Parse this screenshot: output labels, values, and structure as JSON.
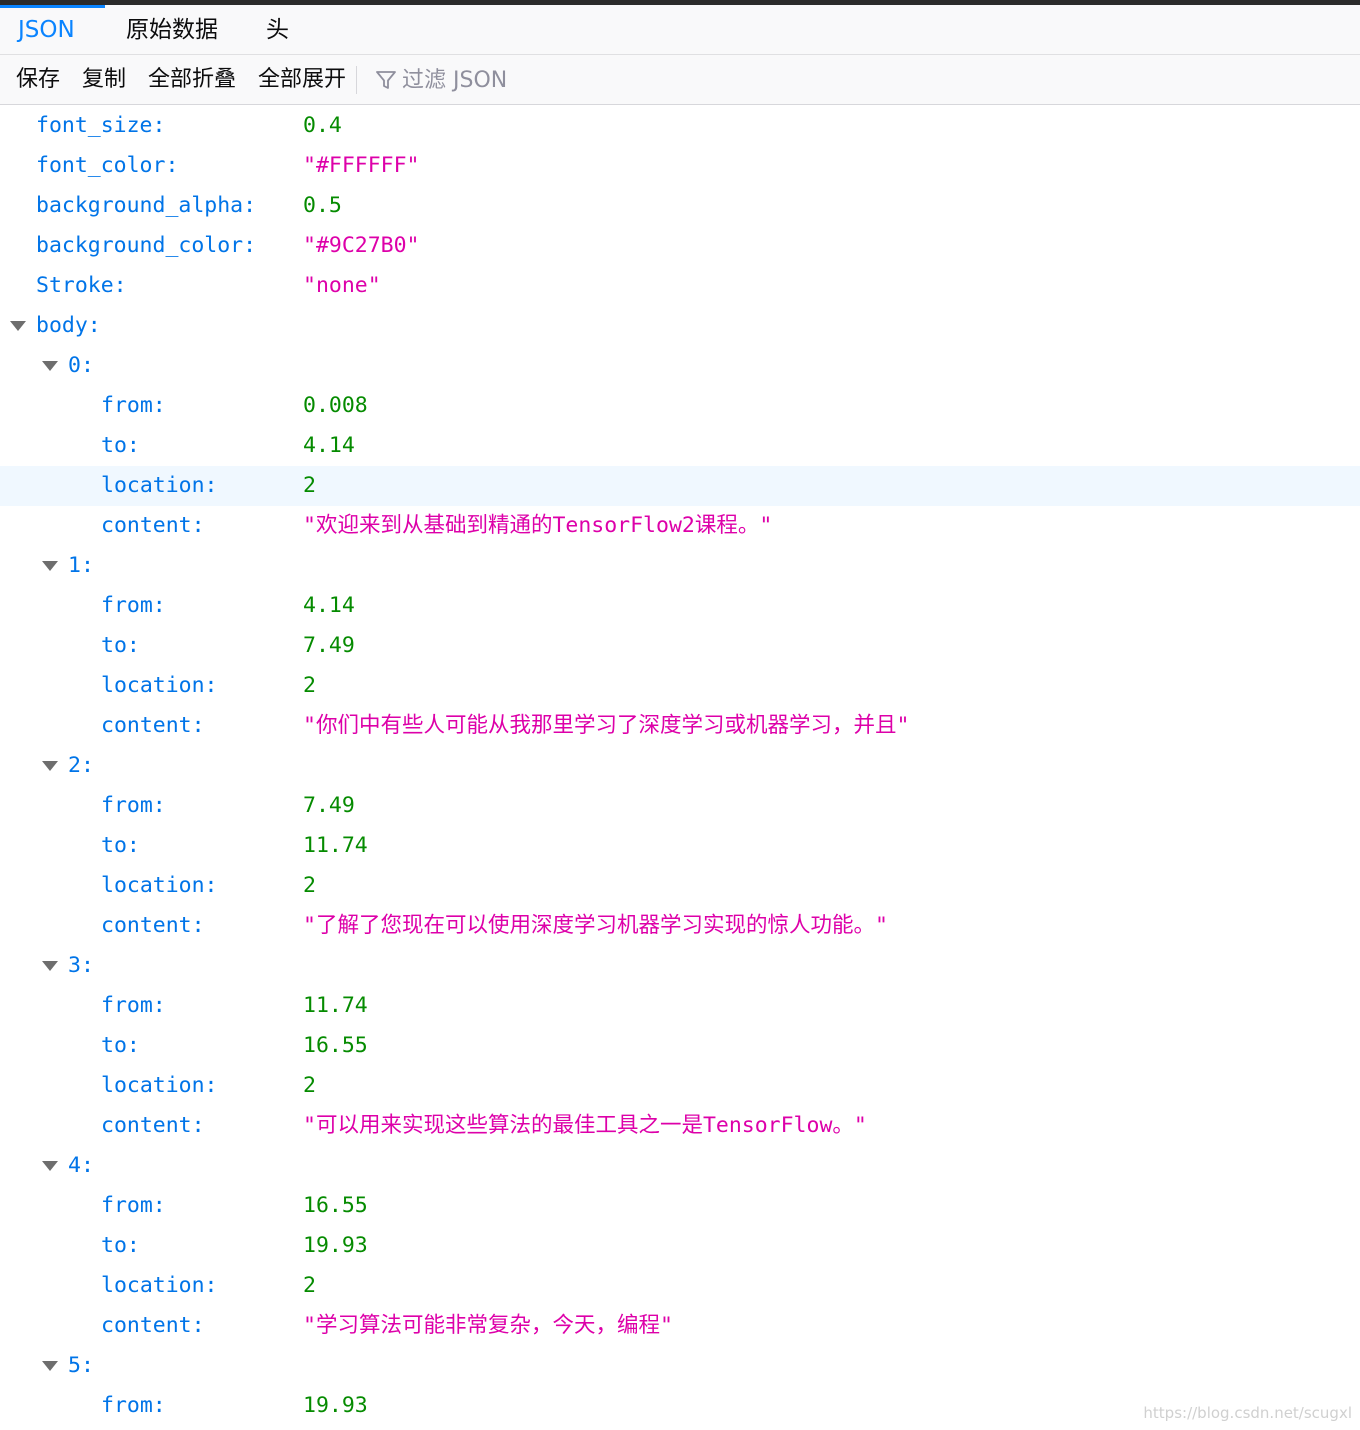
{
  "tabs": [
    "JSON",
    "原始数据",
    "头"
  ],
  "toolbar": {
    "save": "保存",
    "copy": "复制",
    "collapse_all": "全部折叠",
    "expand_all": "全部展开",
    "filter_placeholder": "过滤 JSON"
  },
  "rows": [
    {
      "key": "font_size:",
      "value": "0.4",
      "type": "number"
    },
    {
      "key": "font_color:",
      "value": "\"#FFFFFF\"",
      "type": "string"
    },
    {
      "key": "background_alpha:",
      "value": "0.5",
      "type": "number"
    },
    {
      "key": "background_color:",
      "value": "\"#9C27B0\"",
      "type": "string"
    },
    {
      "key": "Stroke:",
      "value": "\"none\"",
      "type": "string"
    },
    {
      "key": "body:"
    },
    {
      "key": "0:"
    },
    {
      "key": "from:",
      "value": "0.008",
      "type": "number"
    },
    {
      "key": "to:",
      "value": "4.14",
      "type": "number"
    },
    {
      "key": "location:",
      "value": "2",
      "type": "number",
      "highlighted": true
    },
    {
      "key": "content:",
      "value": "\"欢迎来到从基础到精通的TensorFlow2课程。\"",
      "type": "string"
    },
    {
      "key": "1:"
    },
    {
      "key": "from:",
      "value": "4.14",
      "type": "number"
    },
    {
      "key": "to:",
      "value": "7.49",
      "type": "number"
    },
    {
      "key": "location:",
      "value": "2",
      "type": "number"
    },
    {
      "key": "content:",
      "value": "\"你们中有些人可能从我那里学习了深度学习或机器学习，并且\"",
      "type": "string"
    },
    {
      "key": "2:"
    },
    {
      "key": "from:",
      "value": "7.49",
      "type": "number"
    },
    {
      "key": "to:",
      "value": "11.74",
      "type": "number"
    },
    {
      "key": "location:",
      "value": "2",
      "type": "number"
    },
    {
      "key": "content:",
      "value": "\"了解了您现在可以使用深度学习机器学习实现的惊人功能。\"",
      "type": "string"
    },
    {
      "key": "3:"
    },
    {
      "key": "from:",
      "value": "11.74",
      "type": "number"
    },
    {
      "key": "to:",
      "value": "16.55",
      "type": "number"
    },
    {
      "key": "location:",
      "value": "2",
      "type": "number"
    },
    {
      "key": "content:",
      "value": "\"可以用来实现这些算法的最佳工具之一是TensorFlow。\"",
      "type": "string"
    },
    {
      "key": "4:"
    },
    {
      "key": "from:",
      "value": "16.55",
      "type": "number"
    },
    {
      "key": "to:",
      "value": "19.93",
      "type": "number"
    },
    {
      "key": "location:",
      "value": "2",
      "type": "number"
    },
    {
      "key": "content:",
      "value": "\"学习算法可能非常复杂，今天，编程\"",
      "type": "string"
    },
    {
      "key": "5:"
    },
    {
      "key": "from:",
      "value": "19.93",
      "type": "number"
    }
  ],
  "watermark": "https://blog.csdn.net/scugxl",
  "colors": {
    "key": "#0074e8",
    "number": "#058b00",
    "string": "#dd00a9",
    "accent": "#0a84ff"
  }
}
